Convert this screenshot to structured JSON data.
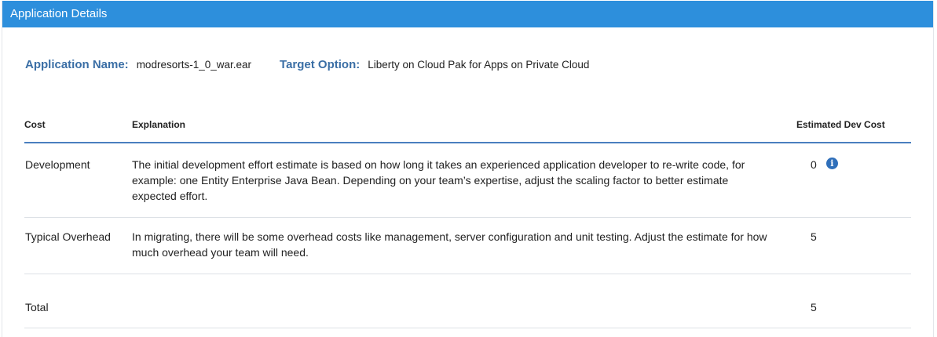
{
  "header": {
    "title": "Application Details"
  },
  "app_info": {
    "name_label": "Application Name:",
    "name_value": "modresorts-1_0_war.ear",
    "target_label": "Target Option:",
    "target_value": "Liberty on Cloud Pak for Apps on Private Cloud"
  },
  "table": {
    "columns": {
      "cost": "Cost",
      "explanation": "Explanation",
      "estimate": "Estimated Dev Cost"
    },
    "rows": [
      {
        "cost": "Development",
        "explanation": "The initial development effort estimate is based on how long it takes an experienced application developer to re-write code, for example: one Entity Enterprise Java Bean. Depending on your team’s expertise, adjust the scaling factor to better estimate expected effort.",
        "estimate": "0",
        "icon": "info-icon"
      },
      {
        "cost": "Typical Overhead",
        "explanation": "In migrating, there will be some overhead costs like management, server configuration and unit testing. Adjust the estimate for how much overhead your team will need.",
        "estimate": "5"
      },
      {
        "cost": "Total",
        "explanation": "",
        "estimate": "5"
      }
    ]
  },
  "colors": {
    "header_bg": "#2d8fdc",
    "label_blue": "#3a6ea5",
    "table_rule": "#4a7fbf",
    "info_icon": "#2f6fba"
  }
}
